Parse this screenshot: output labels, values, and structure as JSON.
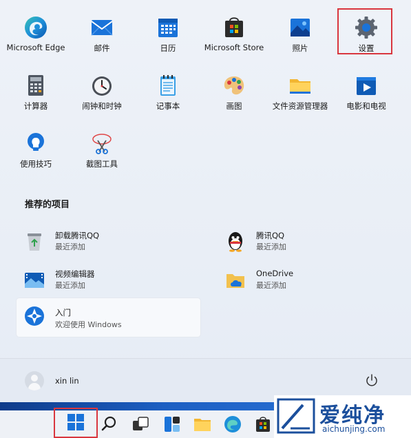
{
  "pinned": [
    {
      "label": "Microsoft Edge",
      "icon": "edge-icon"
    },
    {
      "label": "邮件",
      "icon": "mail-icon"
    },
    {
      "label": "日历",
      "icon": "calendar-icon"
    },
    {
      "label": "Microsoft Store",
      "icon": "store-icon"
    },
    {
      "label": "照片",
      "icon": "photos-icon"
    },
    {
      "label": "设置",
      "icon": "settings-icon"
    },
    {
      "label": "计算器",
      "icon": "calculator-icon"
    },
    {
      "label": "闹钟和时钟",
      "icon": "clock-icon"
    },
    {
      "label": "记事本",
      "icon": "notepad-icon"
    },
    {
      "label": "画图",
      "icon": "paint-icon"
    },
    {
      "label": "文件资源管理器",
      "icon": "folder-icon"
    },
    {
      "label": "电影和电视",
      "icon": "movies-icon"
    },
    {
      "label": "使用技巧",
      "icon": "tips-icon"
    },
    {
      "label": "截图工具",
      "icon": "snipping-tool-icon"
    }
  ],
  "recommended": {
    "title": "推荐的项目",
    "items": [
      {
        "name": "卸载腾讯QQ",
        "sub": "最近添加",
        "icon": "recycle-bin-icon"
      },
      {
        "name": "腾讯QQ",
        "sub": "最近添加",
        "icon": "qq-penguin-icon"
      },
      {
        "name": "视频编辑器",
        "sub": "最近添加",
        "icon": "video-editor-icon"
      },
      {
        "name": "OneDrive",
        "sub": "最近添加",
        "icon": "onedrive-folder-icon"
      },
      {
        "name": "入门",
        "sub": "欢迎使用 Windows",
        "icon": "get-started-icon"
      }
    ]
  },
  "user": {
    "name": "xin lin"
  },
  "watermark": {
    "brand": "爱纯净",
    "site": "aichunjing.com"
  },
  "colors": {
    "highlight": "#d9363e",
    "accent": "#0067c0"
  }
}
